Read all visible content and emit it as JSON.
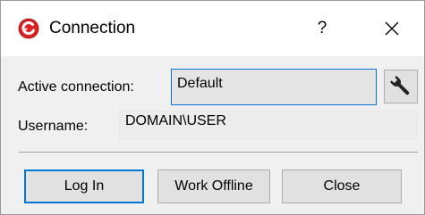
{
  "window": {
    "title": "Connection",
    "help_label": "?",
    "accent_color": "#0078d7",
    "app_icon_color": "#e02020"
  },
  "form": {
    "active_connection_label": "Active connection:",
    "active_connection_value": "Default",
    "username_label": "Username:",
    "username_value": "DOMAIN\\USER"
  },
  "icons": {
    "app": "app-logo-icon",
    "settings": "wrench-icon",
    "close": "close-icon"
  },
  "buttons": {
    "login": "Log In",
    "offline": "Work Offline",
    "close": "Close"
  }
}
